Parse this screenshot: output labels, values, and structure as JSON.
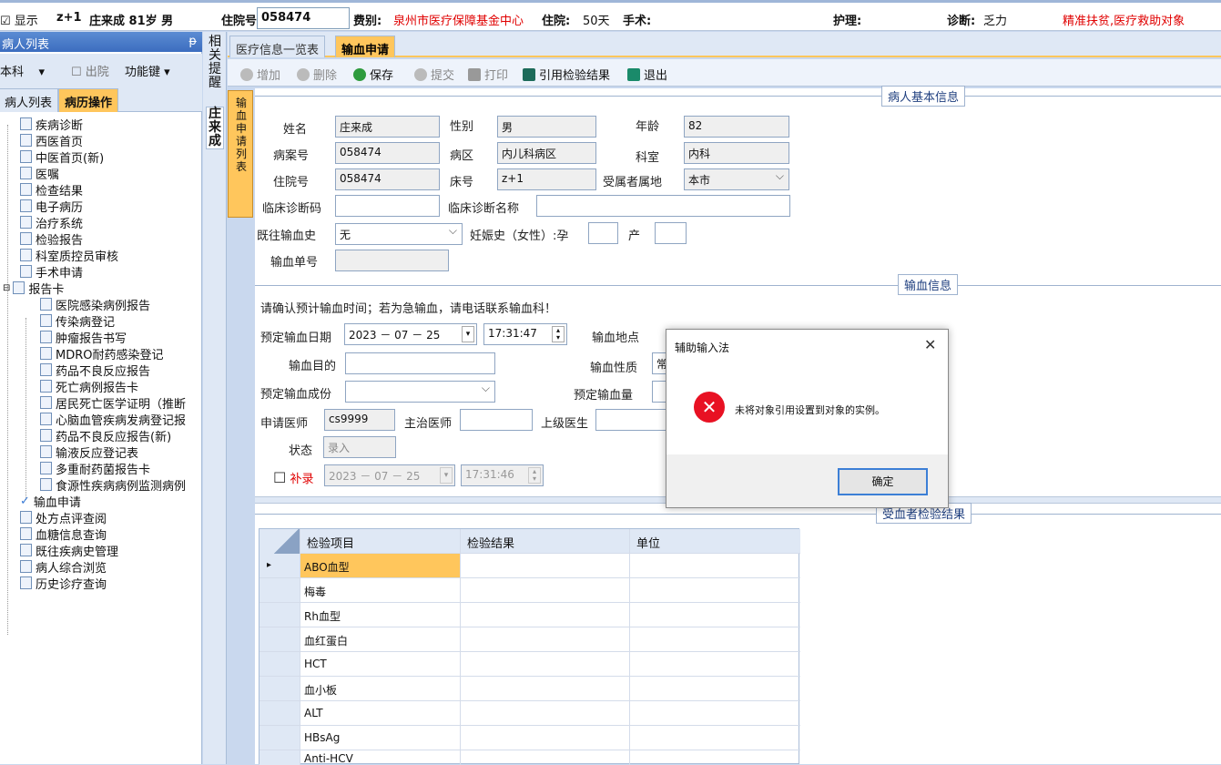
{
  "topbar": {
    "show_label": "显示",
    "bed": "z+1",
    "patient": "庄来成 81岁 男",
    "admission_label": "住院号:",
    "admission_value": "058474",
    "fee_label": "费别:",
    "fee_value": "泉州市医疗保障基金中心",
    "stay_label": "住院:",
    "stay_value": "50天",
    "surgery_label": "手术:",
    "nursing_label": "护理:",
    "diag_label": "诊断:",
    "diag_value": "乏力",
    "flag_text": "精准扶贫,医疗救助对象"
  },
  "left": {
    "title": "病人列表",
    "pin": "ᵽ",
    "dept": "本科",
    "discharge_label": "出院",
    "func_label": "功能键",
    "tab_list": "病人列表",
    "tab_record": "病历操作",
    "tree": [
      "疾病诊断",
      "西医首页",
      "中医首页(新)",
      "医嘱",
      "检查结果",
      "电子病历",
      "治疗系统",
      "检验报告",
      "科室质控员审核",
      "手术申请",
      "报告卡",
      "医院感染病例报告",
      "传染病登记",
      "肿瘤报告书写",
      "MDRO耐药感染登记",
      "药品不良反应报告",
      "死亡病例报告卡",
      "居民死亡医学证明（推断",
      "心脑血管疾病发病登记报",
      "药品不良反应报告(新)",
      "输液反应登记表",
      "多重耐药菌报告卡",
      "食源性疾病病例监测病例",
      "输血申请",
      "处方点评查阅",
      "血糖信息查询",
      "既往疾病史管理",
      "病人综合浏览",
      "历史诊疗查询"
    ]
  },
  "vstrip": {
    "remind": "相关提醒",
    "patient": "庄来成"
  },
  "main": {
    "tab1": "医疗信息一览表",
    "tab2": "输血申请",
    "toolbar": {
      "add": "增加",
      "del": "删除",
      "save": "保存",
      "submit": "提交",
      "print": "打印",
      "cite": "引用检验结果",
      "exit": "退出"
    },
    "side_tab": "输血申请列表"
  },
  "basic": {
    "group": "病人基本信息",
    "name_l": "姓名",
    "name_v": "庄来成",
    "sex_l": "性别",
    "sex_v": "男",
    "age_l": "年龄",
    "age_v": "82",
    "case_l": "病案号",
    "case_v": "058474",
    "ward_l": "病区",
    "ward_v": "内儿科病区",
    "dept_l": "科室",
    "dept_v": "内科",
    "adm_l": "住院号",
    "adm_v": "058474",
    "bed_l": "床号",
    "bed_v": "z+1",
    "place_l": "受属者属地",
    "place_v": "本市",
    "dcode_l": "临床诊断码",
    "dname_l": "临床诊断名称",
    "hist_l": "既往输血史",
    "hist_v": "无",
    "preg_l": "妊娠史（女性）:孕",
    "birth_l": "产",
    "order_l": "输血单号"
  },
  "transfusion": {
    "group": "输血信息",
    "warning": "请确认预计输血时间；若为急输血，请电话联系输血科！",
    "date_l": "预定输血日期",
    "date_v": "2023 － 07 － 25",
    "time_v": "17:31:47",
    "place_l": "输血地点",
    "purpose_l": "输血目的",
    "nature_l": "输血性质",
    "nature_v": "常",
    "comp_l": "预定输血成份",
    "amount_l": "预定输血量",
    "req_l": "申请医师",
    "req_v": "cs9999",
    "chief_l": "主治医师",
    "sup_l": "上级医生",
    "status_l": "状态",
    "status_v": "录入",
    "supp_l": "补录",
    "supp_date": "2023 － 07 － 25",
    "supp_time": "17:31:46"
  },
  "results": {
    "group": "受血者检验结果",
    "headers": [
      "检验项目",
      "检验结果",
      "单位"
    ],
    "rows": [
      "ABO血型",
      "梅毒",
      "Rh血型",
      "血红蛋白",
      "HCT",
      "血小板",
      "ALT",
      "HBsAg",
      "Anti-HCV"
    ]
  },
  "dialog": {
    "title": "辅助输入法",
    "close": "✕",
    "message": "未将对象引用设置到对象的实例。",
    "ok": "确定"
  },
  "colors": {
    "accent": "#ffc65c",
    "red": "#e00000",
    "header": "#3c6dbf",
    "error": "#e81123"
  }
}
